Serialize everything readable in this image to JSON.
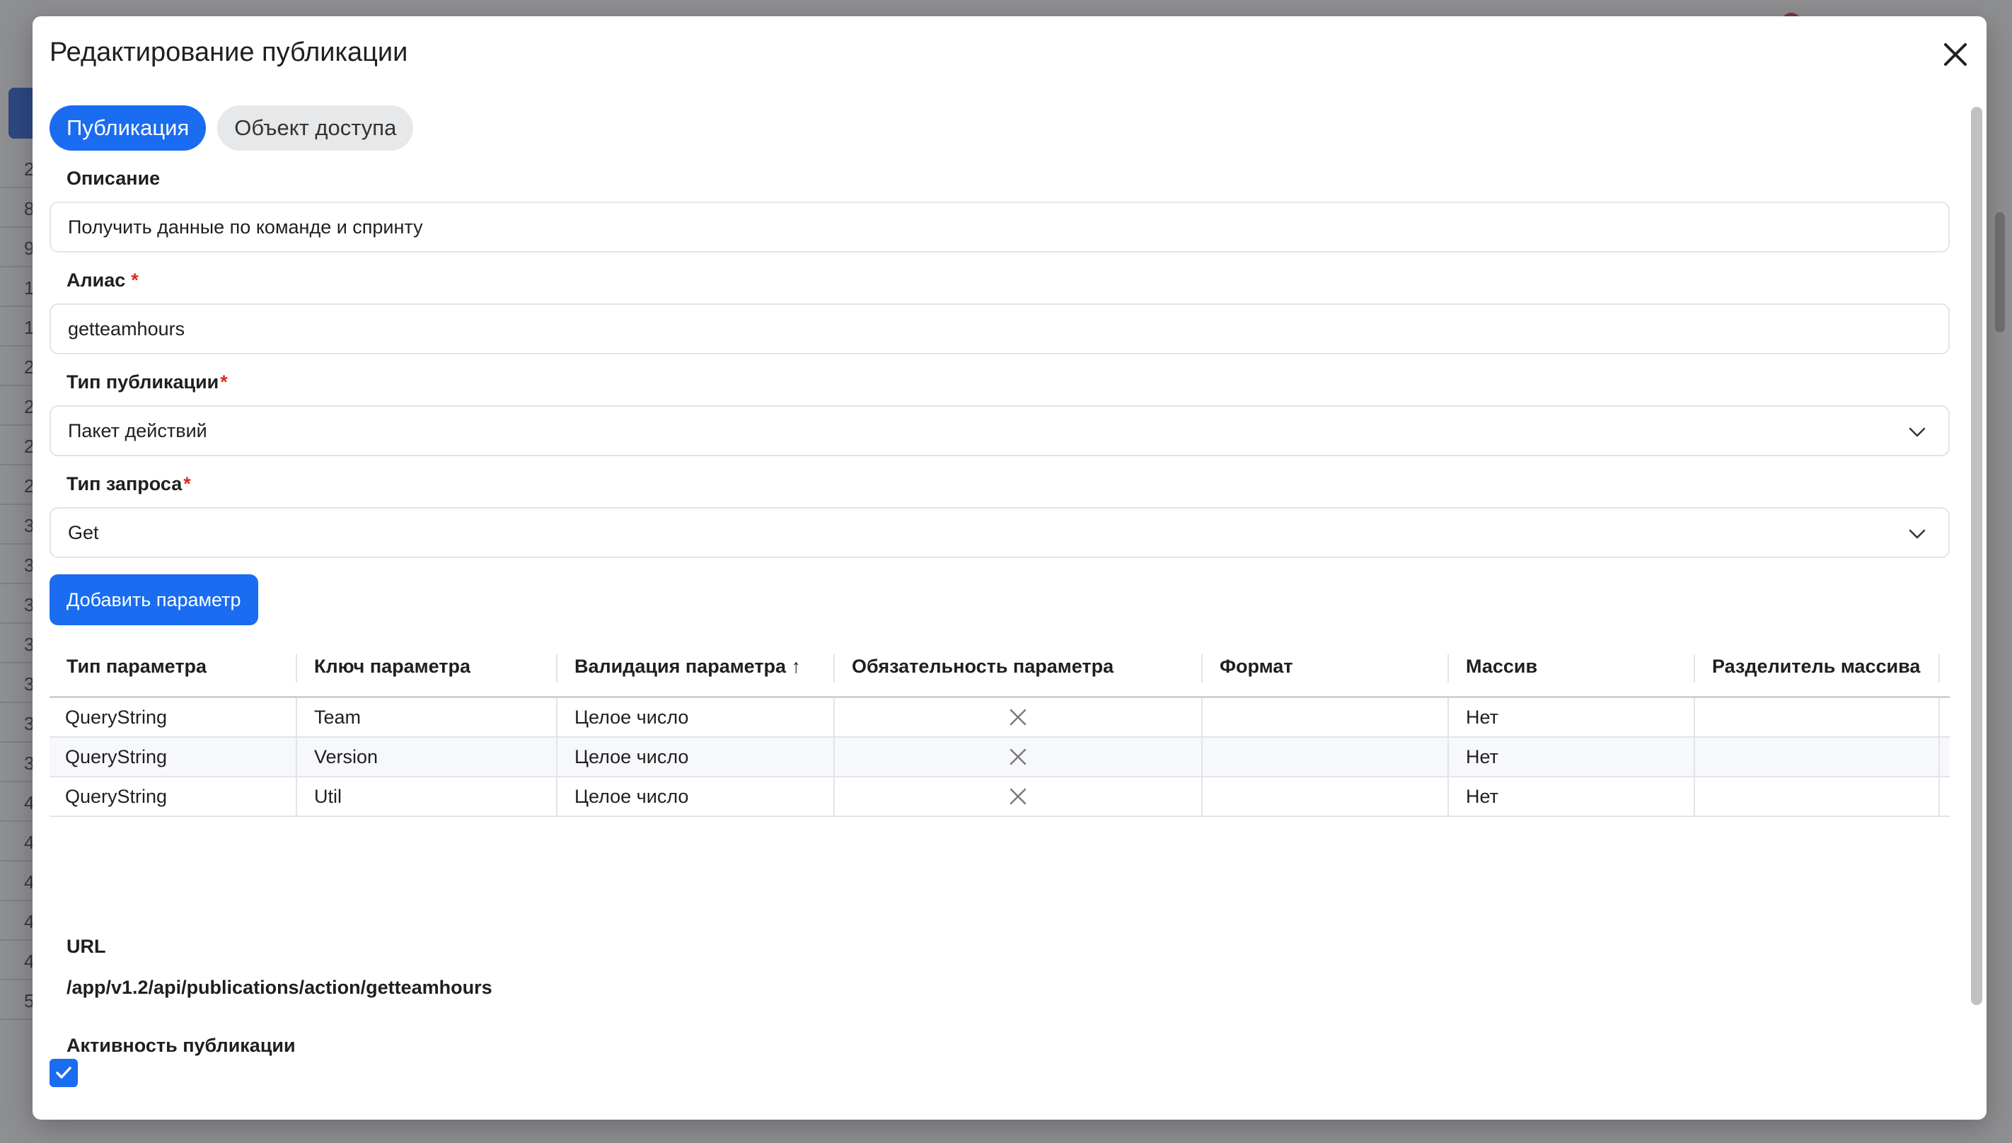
{
  "modal": {
    "title": "Редактирование публикации"
  },
  "tabs": [
    {
      "label": "Публикация",
      "active": true
    },
    {
      "label": "Объект доступа",
      "active": false
    }
  ],
  "form": {
    "description_label": "Описание",
    "description_value": "Получить данные по команде и спринту",
    "alias_label": "Алиас",
    "alias_value": "getteamhours",
    "pub_type_label": "Тип публикации",
    "pub_type_value": "Пакет действий",
    "request_type_label": "Тип запроса",
    "request_type_value": "Get",
    "required_mark": "*"
  },
  "add_param_button": "Добавить параметр",
  "table": {
    "headers": [
      "Тип параметра",
      "Ключ параметра",
      "Валидация параметра ↑",
      "Обязательность параметра",
      "Формат",
      "Массив",
      "Разделитель массива"
    ],
    "rows": [
      {
        "type": "QueryString",
        "key": "Team",
        "validation": "Целое число",
        "required": false,
        "format": "",
        "array": "Нет",
        "separator": ""
      },
      {
        "type": "QueryString",
        "key": "Version",
        "validation": "Целое число",
        "required": false,
        "format": "",
        "array": "Нет",
        "separator": ""
      },
      {
        "type": "QueryString",
        "key": "Util",
        "validation": "Целое число",
        "required": false,
        "format": "",
        "array": "Нет",
        "separator": ""
      }
    ]
  },
  "url": {
    "label": "URL",
    "value": "/app/v1.2/api/publications/action/getteamhours"
  },
  "activity": {
    "label": "Активность публикации",
    "checked": true
  },
  "background_rows": [
    "2",
    "8",
    "9",
    "1",
    "1",
    "2",
    "2",
    "2",
    "2",
    "3",
    "3",
    "3",
    "3",
    "3",
    "3",
    "3",
    "4",
    "4",
    "4",
    "4",
    "4",
    "5"
  ],
  "colors": {
    "accent": "#1a6cf0",
    "required": "#d92d20",
    "border": "#e2e4e8"
  }
}
